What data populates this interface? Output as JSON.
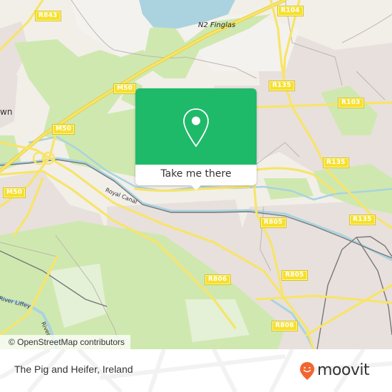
{
  "map": {
    "attribution": "© OpenStreetMap contributors",
    "place_labels": {
      "finglas": "N2 Finglas",
      "town_partial": "wn"
    },
    "water_labels": {
      "royal_canal": "Royal Canal",
      "river_liffey": "River Liffey",
      "river_partial": "River"
    },
    "road_shields": {
      "r843": "R843",
      "r104": "R104",
      "m50_a": "M50",
      "m50_b": "M50",
      "m50_c": "M50",
      "r135_a": "R135",
      "r135_b": "R135",
      "r135_c": "R135",
      "r103": "R103",
      "r805_a": "R805",
      "r805_b": "R805",
      "r806_a": "R806",
      "r806_b": "R806"
    },
    "colors": {
      "background": "#f2efe9",
      "park": "#cfe8b0",
      "water": "#aad3df",
      "road": "#f6e02b",
      "rail": "#777777"
    }
  },
  "popup": {
    "icon": "location-pin-icon",
    "button_label": "Take me there",
    "accent_color": "#1fb96a"
  },
  "footer": {
    "place_title": "The Pig and Heifer, Ireland",
    "brand": "moovit",
    "brand_color": "#f26531"
  }
}
